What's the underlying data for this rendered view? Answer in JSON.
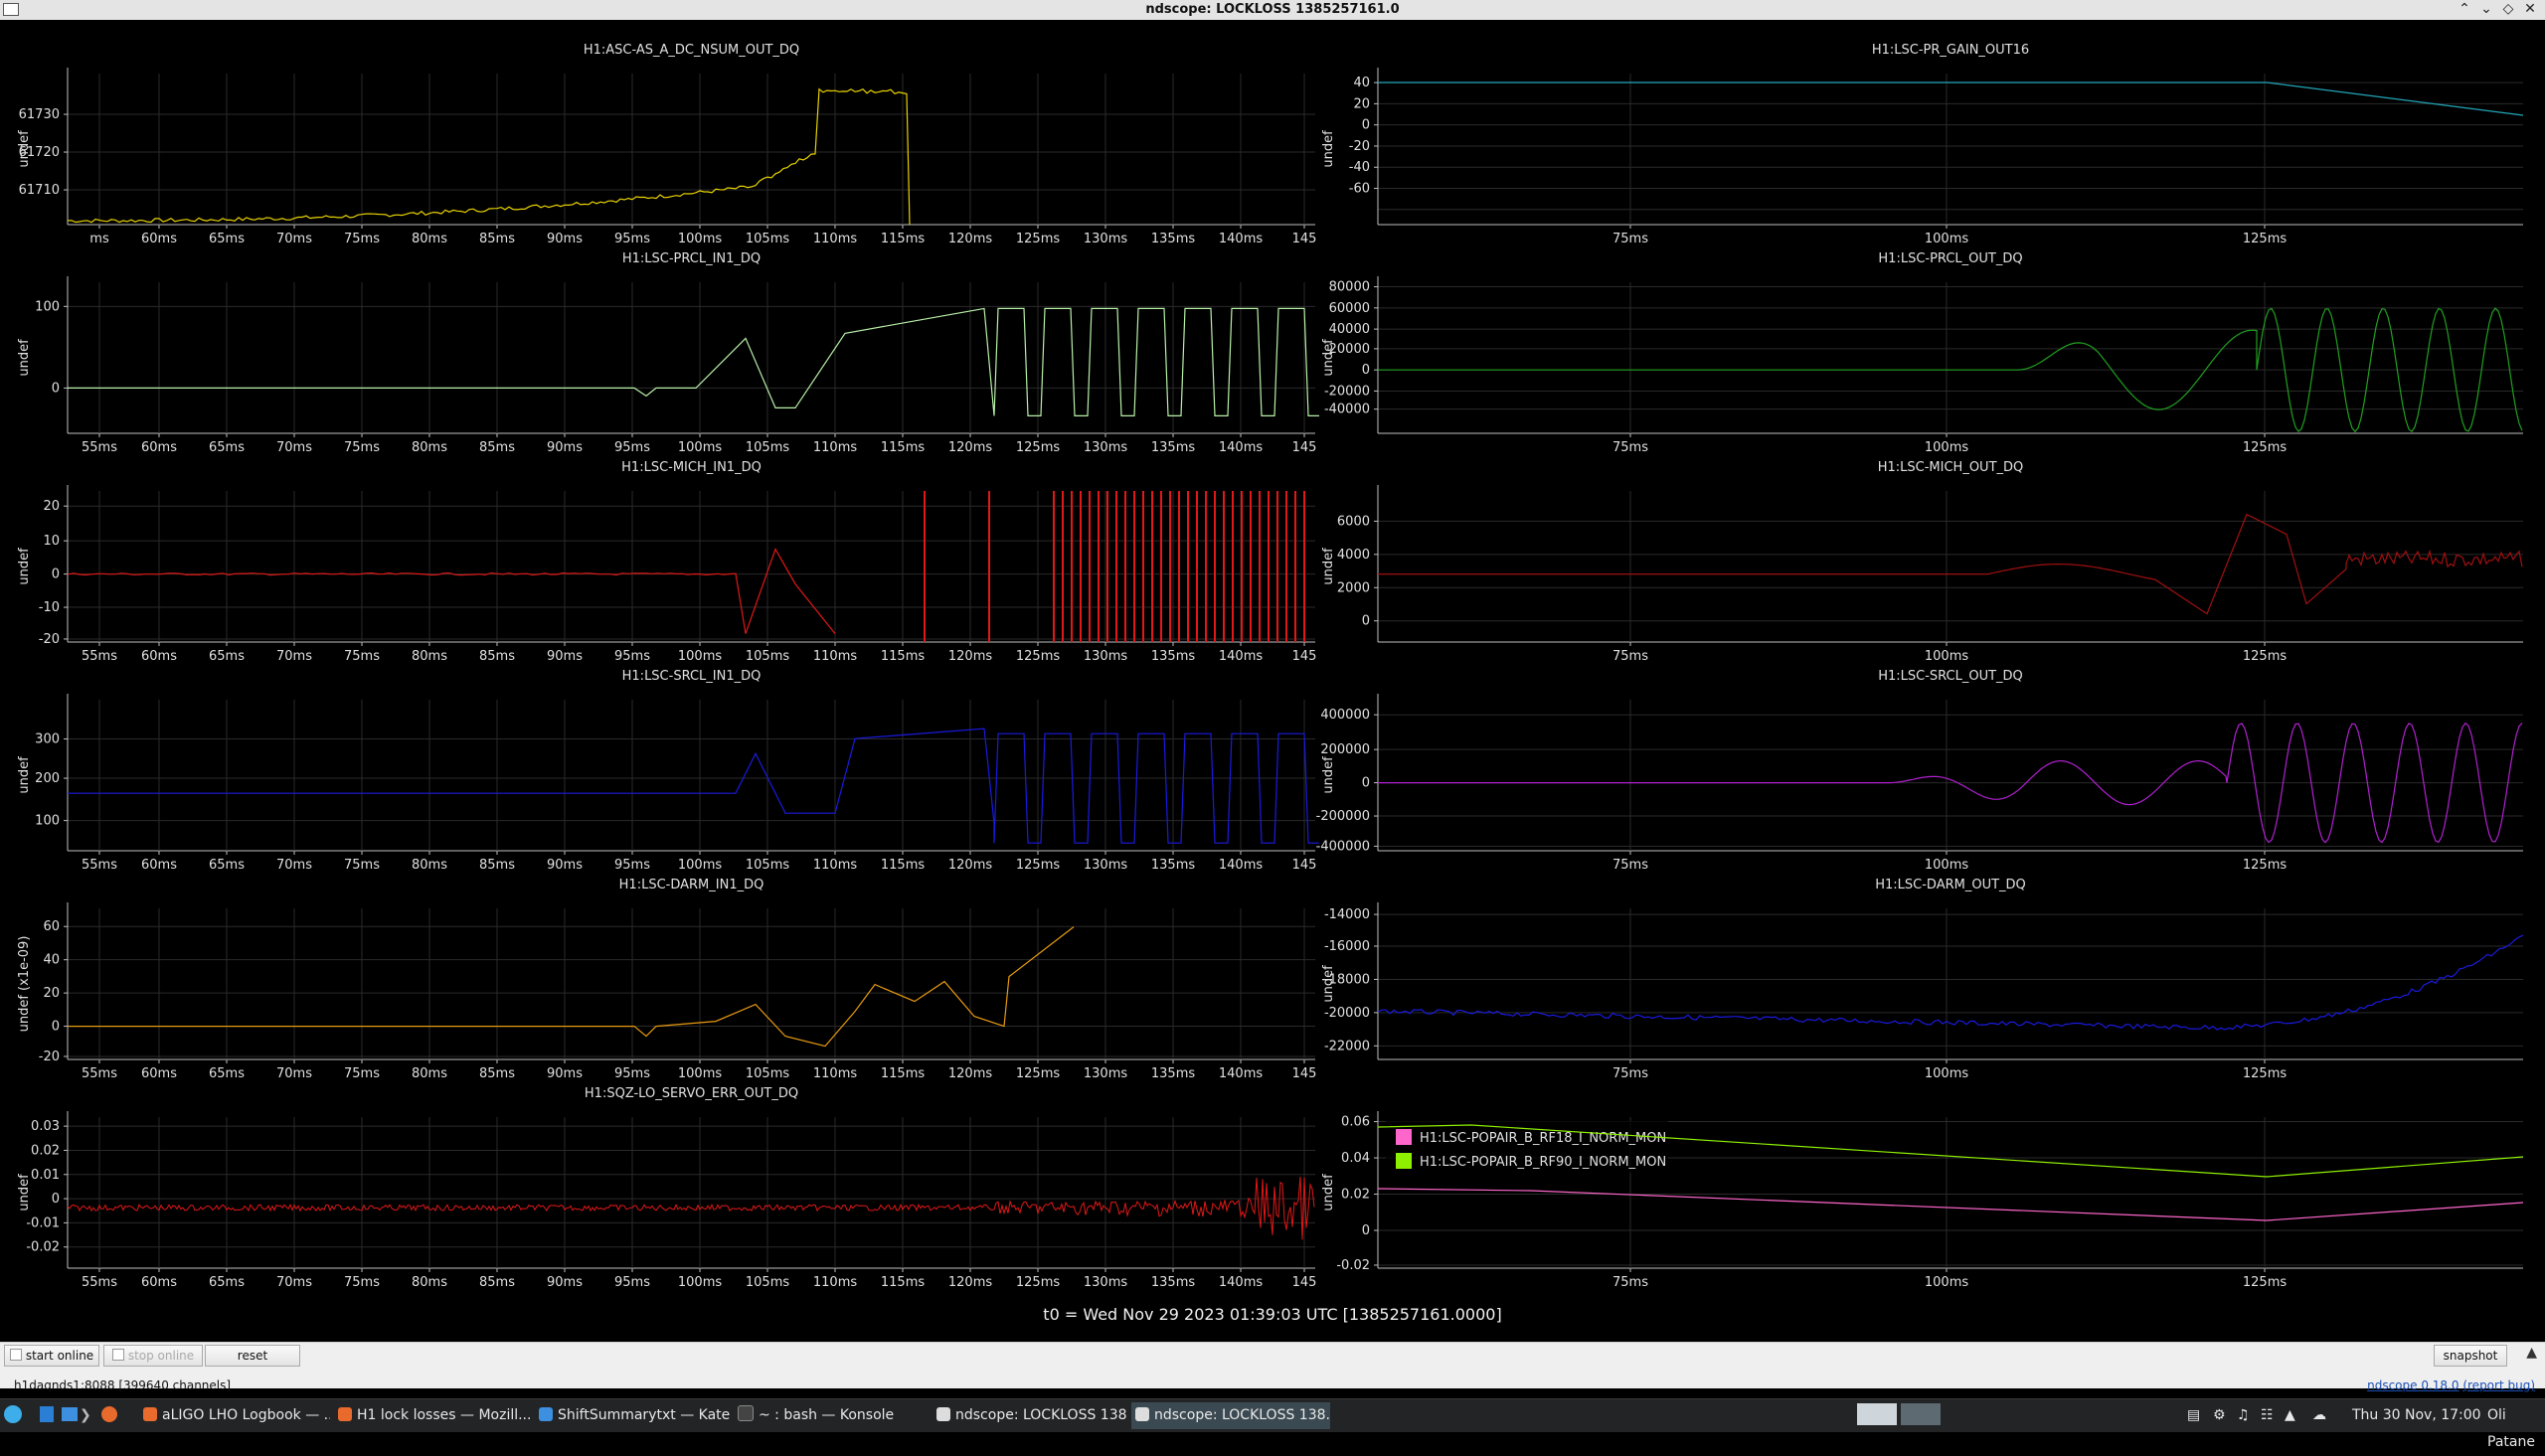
{
  "window": {
    "title": "ndscope: LOCKLOSS 1385257161.0"
  },
  "colors": {
    "background": "#000000",
    "yellow": "#e8d200",
    "cyan": "#22a6b8",
    "lightgreen": "#b8f0a8",
    "green": "#20a020",
    "red": "#e01818",
    "darkred": "#a01010",
    "blue": "#1a1ae0",
    "purple": "#b020d0",
    "orange": "#e89a10",
    "pink": "#ff66cc",
    "lime": "#8ef000"
  },
  "plots": [
    {
      "title": "H1:ASC-AS_A_DC_NSUM_OUT_DQ",
      "ylabel": "undef",
      "yticks": [
        "61730",
        "61720",
        "61710"
      ],
      "xticks": [
        "ms",
        "60ms",
        "65ms",
        "70ms",
        "75ms",
        "80ms",
        "85ms",
        "90ms",
        "95ms",
        "100ms",
        "105ms",
        "110ms",
        "115ms",
        "120ms",
        "125ms",
        "130ms",
        "135ms",
        "140ms",
        "145"
      ]
    },
    {
      "title": "H1:LSC-PR_GAIN_OUT16",
      "ylabel": "undef",
      "yticks": [
        "40",
        "20",
        "0",
        "-20",
        "-40",
        "-60"
      ],
      "xticks": [
        "75ms",
        "100ms",
        "125ms"
      ]
    },
    {
      "title": "H1:LSC-PRCL_IN1_DQ",
      "ylabel": "undef",
      "yticks": [
        "100",
        "0"
      ],
      "xticks": [
        "55ms",
        "60ms",
        "65ms",
        "70ms",
        "75ms",
        "80ms",
        "85ms",
        "90ms",
        "95ms",
        "100ms",
        "105ms",
        "110ms",
        "115ms",
        "120ms",
        "125ms",
        "130ms",
        "135ms",
        "140ms",
        "145"
      ]
    },
    {
      "title": "H1:LSC-PRCL_OUT_DQ",
      "ylabel": "undef",
      "yticks": [
        "80000",
        "60000",
        "40000",
        "20000",
        "0",
        "-20000",
        "-40000"
      ],
      "xticks": [
        "75ms",
        "100ms",
        "125ms"
      ]
    },
    {
      "title": "H1:LSC-MICH_IN1_DQ",
      "ylabel": "undef",
      "yticks": [
        "20",
        "10",
        "0",
        "-10",
        "-20"
      ],
      "xticks": [
        "55ms",
        "60ms",
        "65ms",
        "70ms",
        "75ms",
        "80ms",
        "85ms",
        "90ms",
        "95ms",
        "100ms",
        "105ms",
        "110ms",
        "115ms",
        "120ms",
        "125ms",
        "130ms",
        "135ms",
        "140ms",
        "145"
      ]
    },
    {
      "title": "H1:LSC-MICH_OUT_DQ",
      "ylabel": "undef",
      "yticks": [
        "6000",
        "4000",
        "2000",
        "0"
      ],
      "xticks": [
        "75ms",
        "100ms",
        "125ms"
      ]
    },
    {
      "title": "H1:LSC-SRCL_IN1_DQ",
      "ylabel": "undef",
      "yticks": [
        "300",
        "200",
        "100"
      ],
      "xticks": [
        "55ms",
        "60ms",
        "65ms",
        "70ms",
        "75ms",
        "80ms",
        "85ms",
        "90ms",
        "95ms",
        "100ms",
        "105ms",
        "110ms",
        "115ms",
        "120ms",
        "125ms",
        "130ms",
        "135ms",
        "140ms",
        "145"
      ]
    },
    {
      "title": "H1:LSC-SRCL_OUT_DQ",
      "ylabel": "undef",
      "yticks": [
        "400000",
        "200000",
        "0",
        "-200000",
        "-400000"
      ],
      "xticks": [
        "75ms",
        "100ms",
        "125ms"
      ]
    },
    {
      "title": "H1:LSC-DARM_IN1_DQ",
      "ylabel": "undef (x1e-09)",
      "yticks": [
        "60",
        "40",
        "20",
        "0",
        "-20"
      ],
      "xticks": [
        "55ms",
        "60ms",
        "65ms",
        "70ms",
        "75ms",
        "80ms",
        "85ms",
        "90ms",
        "95ms",
        "100ms",
        "105ms",
        "110ms",
        "115ms",
        "120ms",
        "125ms",
        "130ms",
        "135ms",
        "140ms",
        "145"
      ]
    },
    {
      "title": "H1:LSC-DARM_OUT_DQ",
      "ylabel": "undef",
      "yticks": [
        "-14000",
        "-16000",
        "-18000",
        "-20000",
        "-22000"
      ],
      "xticks": [
        "75ms",
        "100ms",
        "125ms"
      ]
    },
    {
      "title": "H1:SQZ-LO_SERVO_ERR_OUT_DQ",
      "ylabel": "undef",
      "yticks": [
        "0.03",
        "0.02",
        "0.01",
        "0",
        "-0.01",
        "-0.02"
      ],
      "xticks": [
        "55ms",
        "60ms",
        "65ms",
        "70ms",
        "75ms",
        "80ms",
        "85ms",
        "90ms",
        "95ms",
        "100ms",
        "105ms",
        "110ms",
        "115ms",
        "120ms",
        "125ms",
        "130ms",
        "135ms",
        "140ms",
        "145"
      ]
    },
    {
      "title": "",
      "ylabel": "undef",
      "yticks": [
        "0.06",
        "0.04",
        "0.02",
        "0",
        "-0.02"
      ],
      "xticks": [
        "75ms",
        "100ms",
        "125ms"
      ],
      "legend": [
        {
          "label": "H1:LSC-POPAIR_B_RF18_I_NORM_MON",
          "color": "#ff66cc"
        },
        {
          "label": "H1:LSC-POPAIR_B_RF90_I_NORM_MON",
          "color": "#8ef000"
        }
      ]
    }
  ],
  "t0_label": "t0 = Wed Nov 29 2023 01:39:03 UTC [1385257161.0000]",
  "controls": {
    "start_online": "start online",
    "stop_online": "stop online",
    "reset": "reset",
    "snapshot": "snapshot",
    "status": "h1daqnds1:8088  [399640 channels]",
    "version": "ndscope 0.18.0",
    "report_bug": "(report bug)"
  },
  "taskbar": {
    "tasks": [
      {
        "label": "aLIGO LHO Logbook — ...",
        "icon": "firefox-icon"
      },
      {
        "label": "H1 lock losses — Mozill...",
        "icon": "firefox-icon"
      },
      {
        "label": "ShiftSummarytxt  — Kate",
        "icon": "kate-icon"
      },
      {
        "label": "~ : bash — Konsole",
        "icon": "konsole-icon"
      },
      {
        "label": "ndscope: LOCKLOSS 138...",
        "icon": "ndscope-icon"
      },
      {
        "label": "ndscope: LOCKLOSS 138...",
        "icon": "ndscope-icon"
      }
    ],
    "clock": "Thu 30 Nov, 17:00",
    "user": "Oli Patane"
  }
}
